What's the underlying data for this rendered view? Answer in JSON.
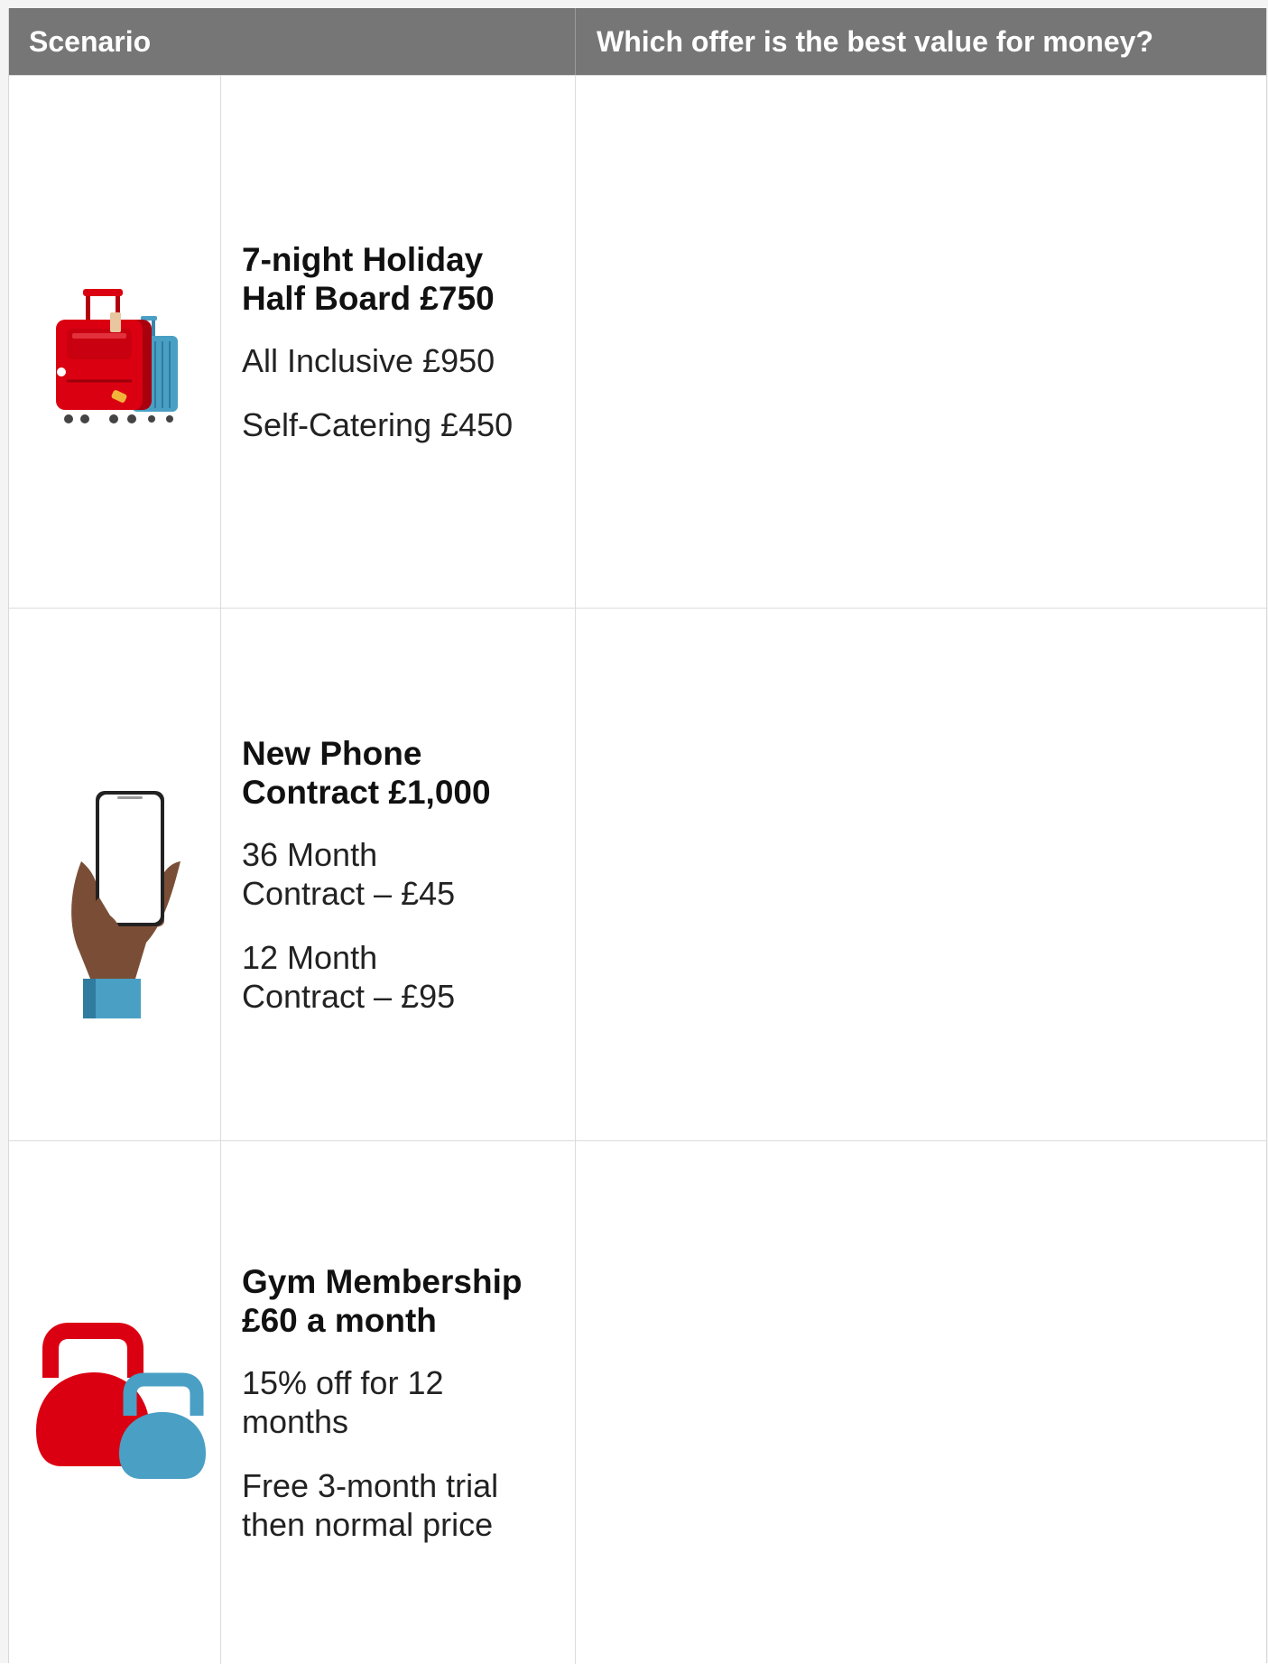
{
  "header": {
    "scenario": "Scenario",
    "question": "Which offer is the best value for money?"
  },
  "rows": [
    {
      "icon": "suitcase-icon",
      "title_line1": "7-night Holiday",
      "title_line2": "Half Board £750",
      "option1": "All Inclusive £950",
      "option2": "Self-Catering £450",
      "answer": ""
    },
    {
      "icon": "phone-in-hand-icon",
      "title_line1": "New Phone",
      "title_line2": "Contract £1,000",
      "option1": "36 Month Contract – £45",
      "option2": "12 Month Contract – £95",
      "answer": ""
    },
    {
      "icon": "kettlebell-icon",
      "title_line1": "Gym Membership",
      "title_line2": "£60 a month",
      "option1": "15% off for 12 months",
      "option2": "Free 3-month trial then normal price",
      "answer": ""
    }
  ],
  "colors": {
    "header_bg": "#767676",
    "red": "#db0011",
    "blue": "#4a9fc4"
  }
}
